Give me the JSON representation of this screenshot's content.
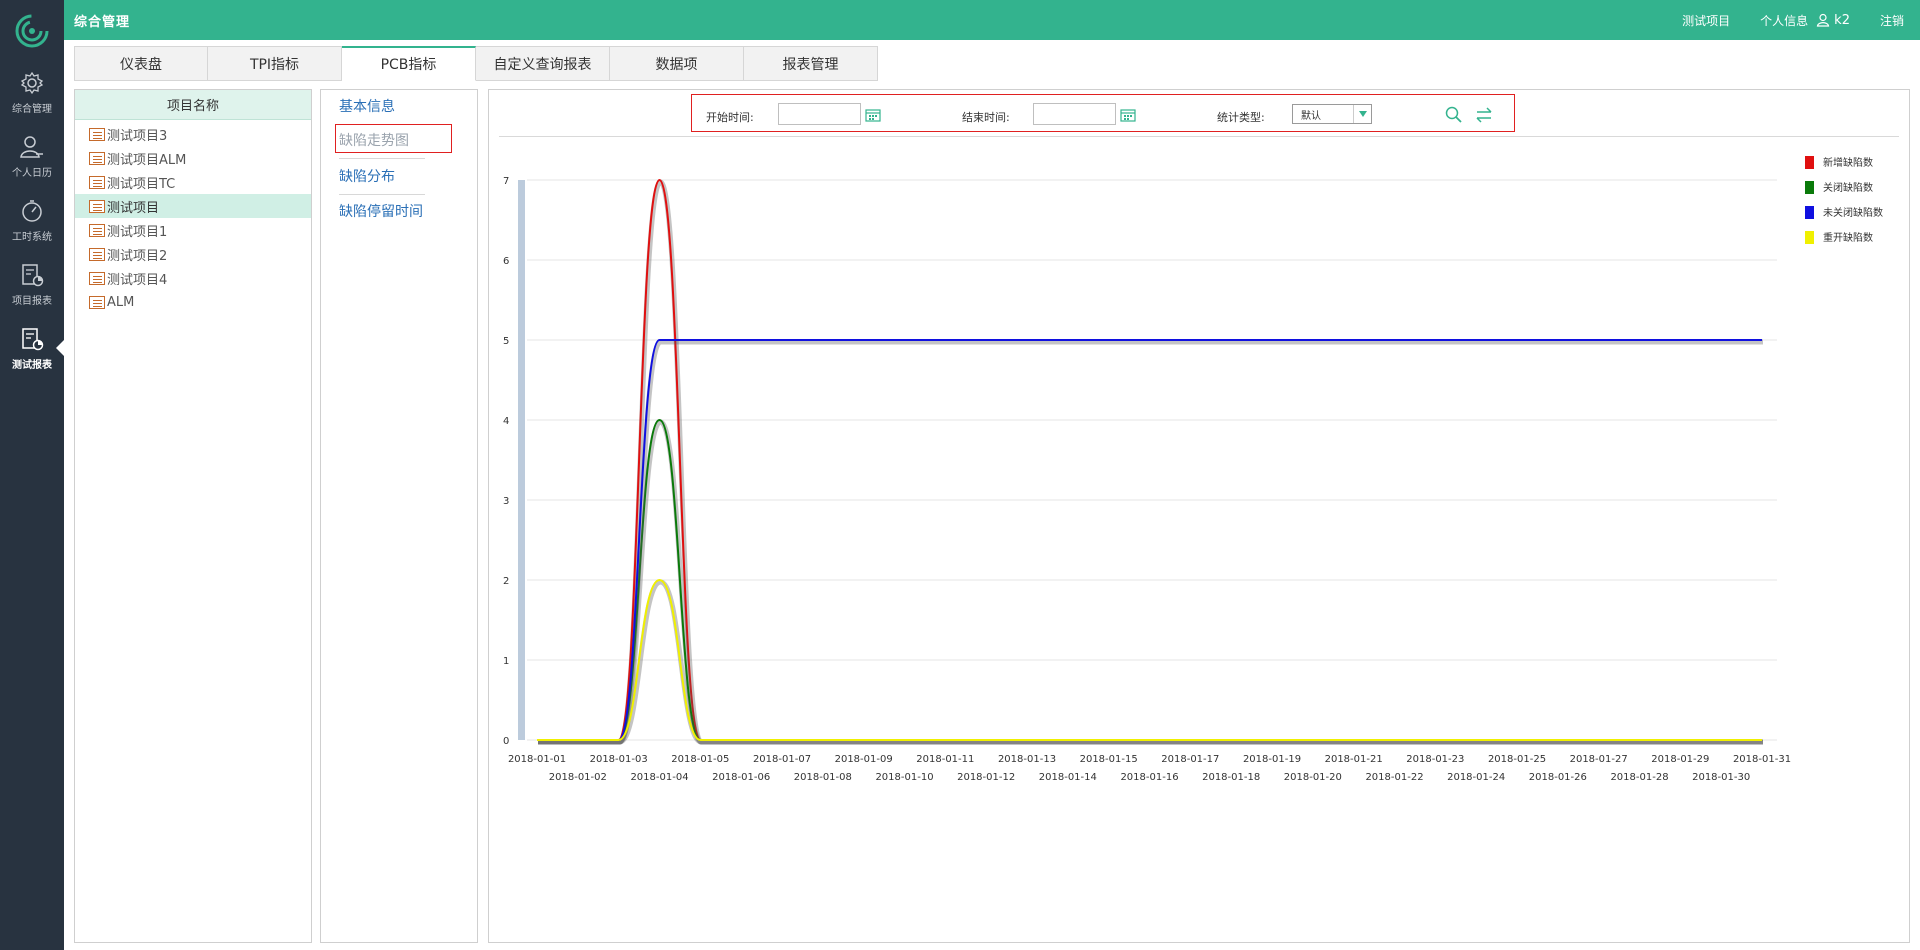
{
  "sidebar": {
    "items": [
      {
        "label": "综合管理",
        "icon": "gear-icon"
      },
      {
        "label": "个人日历",
        "icon": "user-icon"
      },
      {
        "label": "工时系统",
        "icon": "stopwatch-icon"
      },
      {
        "label": "项目报表",
        "icon": "report-chart-icon"
      },
      {
        "label": "测试报表",
        "icon": "test-report-icon"
      }
    ],
    "active_index": 4
  },
  "topbar": {
    "title": "综合管理",
    "current_project": "测试项目",
    "profile_label": "个人信息",
    "username": "k2",
    "logout_label": "注销"
  },
  "tabs": [
    {
      "label": "仪表盘"
    },
    {
      "label": "TPI指标"
    },
    {
      "label": "PCB指标"
    },
    {
      "label": "自定义查询报表"
    },
    {
      "label": "数据项"
    },
    {
      "label": "报表管理"
    }
  ],
  "active_tab": 2,
  "project_panel": {
    "header": "项目名称",
    "items": [
      "测试项目3",
      "测试项目ALM",
      "测试项目TC",
      "测试项目",
      "测试项目1",
      "测试项目2",
      "测试项目4",
      "ALM"
    ],
    "selected_index": 3
  },
  "submenu": {
    "items": [
      "基本信息",
      "缺陷走势图",
      "缺陷分布",
      "缺陷停留时间"
    ],
    "current_index": 1
  },
  "filters": {
    "start_label": "开始时间:",
    "start_value": "",
    "end_label": "结束时间:",
    "end_value": "",
    "type_label": "统计类型:",
    "type_value": "默认"
  },
  "colors": {
    "accent": "#33b38e",
    "nav_bg": "#283340",
    "link": "#2a6fb6",
    "highlight_border": "#e02020"
  },
  "chart_data": {
    "type": "line",
    "x": [
      "2018-01-01",
      "2018-01-02",
      "2018-01-03",
      "2018-01-04",
      "2018-01-05",
      "2018-01-06",
      "2018-01-07",
      "2018-01-08",
      "2018-01-09",
      "2018-01-10",
      "2018-01-11",
      "2018-01-12",
      "2018-01-13",
      "2018-01-14",
      "2018-01-15",
      "2018-01-16",
      "2018-01-17",
      "2018-01-18",
      "2018-01-19",
      "2018-01-20",
      "2018-01-21",
      "2018-01-22",
      "2018-01-23",
      "2018-01-24",
      "2018-01-25",
      "2018-01-26",
      "2018-01-27",
      "2018-01-28",
      "2018-01-29",
      "2018-01-30",
      "2018-01-31"
    ],
    "ylim": [
      0,
      7
    ],
    "yticks": [
      0,
      1,
      2,
      3,
      4,
      5,
      6,
      7
    ],
    "grid": true,
    "legend_position": "top-right",
    "series": [
      {
        "name": "新增缺陷数",
        "color": "#e01010",
        "values": [
          0,
          0,
          0,
          7,
          0,
          0,
          0,
          0,
          0,
          0,
          0,
          0,
          0,
          0,
          0,
          0,
          0,
          0,
          0,
          0,
          0,
          0,
          0,
          0,
          0,
          0,
          0,
          0,
          0,
          0,
          0
        ]
      },
      {
        "name": "关闭缺陷数",
        "color": "#0a7a0a",
        "values": [
          0,
          0,
          0,
          4,
          0,
          0,
          0,
          0,
          0,
          0,
          0,
          0,
          0,
          0,
          0,
          0,
          0,
          0,
          0,
          0,
          0,
          0,
          0,
          0,
          0,
          0,
          0,
          0,
          0,
          0,
          0
        ]
      },
      {
        "name": "未关闭缺陷数",
        "color": "#1010e0",
        "values": [
          0,
          0,
          0,
          5,
          5,
          5,
          5,
          5,
          5,
          5,
          5,
          5,
          5,
          5,
          5,
          5,
          5,
          5,
          5,
          5,
          5,
          5,
          5,
          5,
          5,
          5,
          5,
          5,
          5,
          5,
          5
        ]
      },
      {
        "name": "重开缺陷数",
        "color": "#f0f000",
        "values": [
          0,
          0,
          0,
          2,
          0,
          0,
          0,
          0,
          0,
          0,
          0,
          0,
          0,
          0,
          0,
          0,
          0,
          0,
          0,
          0,
          0,
          0,
          0,
          0,
          0,
          0,
          0,
          0,
          0,
          0,
          0
        ]
      }
    ]
  }
}
